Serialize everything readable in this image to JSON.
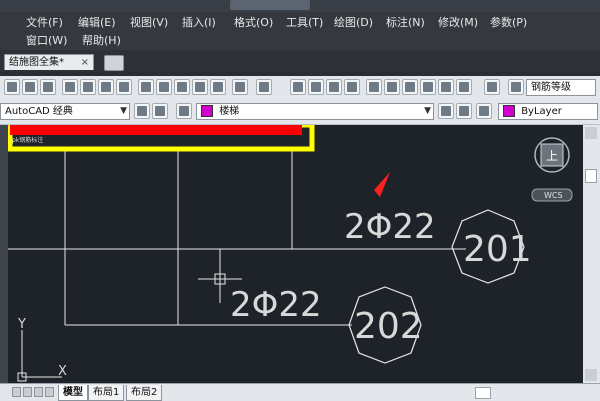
{
  "menu": {
    "row1": [
      "文件(F)",
      "编辑(E)",
      "视图(V)",
      "插入(I)",
      "格式(O)",
      "工具(T)",
      "绘图(D)",
      "标注(N)",
      "修改(M)",
      "参数(P)"
    ],
    "row2": [
      "窗口(W)",
      "帮助(H)"
    ]
  },
  "doc_tab": {
    "label": "结施图全集*",
    "close": "×"
  },
  "toolbar": {
    "workspace": "AutoCAD 经典",
    "layer": "楼梯",
    "text_style": "钢筋等级",
    "color": "ByLayer",
    "color_swatch": "#d000d0"
  },
  "drawing": {
    "rebar_labels": [
      "2Φ22",
      "2Φ22"
    ],
    "bubbles": [
      "201",
      "202"
    ],
    "small_label": "pk钢筋标注",
    "viewcube_center": "上",
    "wcs": "WCS",
    "axis_y": "Y",
    "axis_x": "X",
    "accent_red": "#ff0000",
    "accent_yellow": "#ffff00"
  },
  "layout_tabs": [
    "模型",
    "布局1",
    "布局2"
  ]
}
